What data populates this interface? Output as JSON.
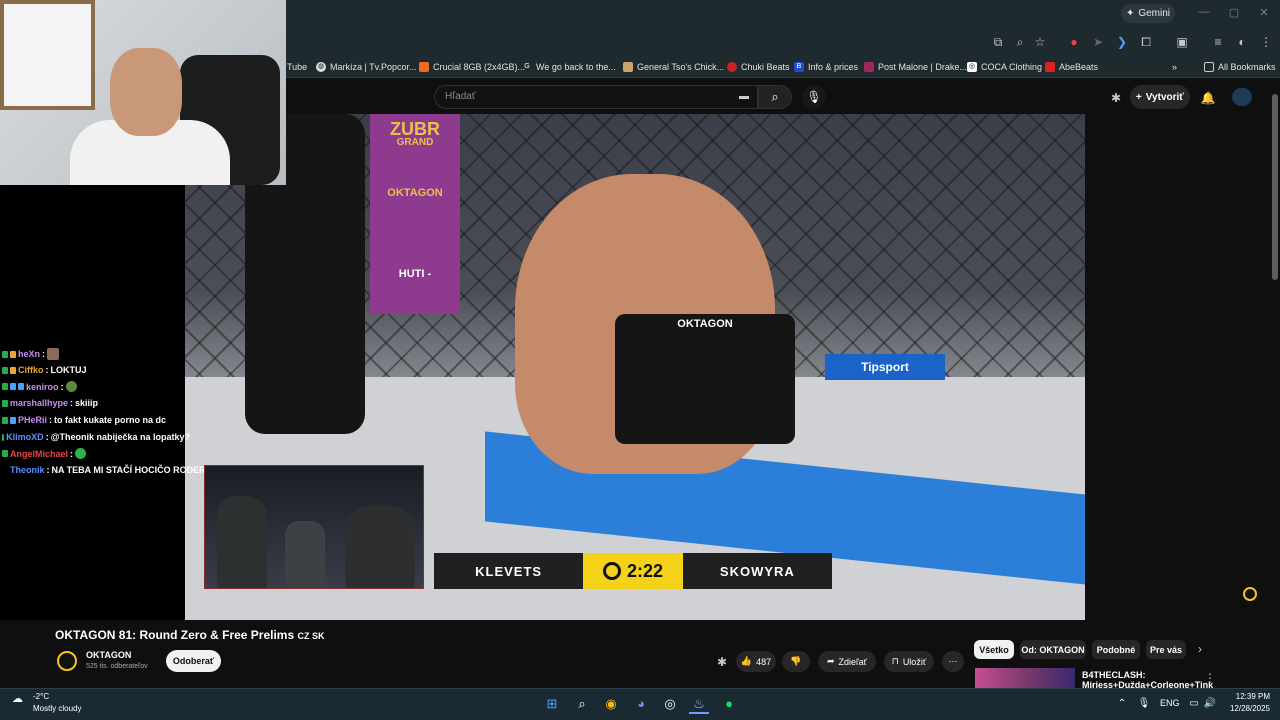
{
  "browser": {
    "gemini_label": "Gemini",
    "bookmarks": [
      {
        "label": "Tube",
        "icon": "youtube-icon"
      },
      {
        "label": "Markíza | Tv.Popcor...",
        "icon": "globe-icon"
      },
      {
        "label": "Crucial 8GB (2x4GB)...",
        "icon": "crucial-icon"
      },
      {
        "label": "We go back to the...",
        "icon": "google-icon"
      },
      {
        "label": "General Tso's Chick...",
        "icon": "recipe-icon"
      },
      {
        "label": "Chuki Beats",
        "icon": "chuki-icon"
      },
      {
        "label": "Info & prices",
        "icon": "b-icon"
      },
      {
        "label": "Post Malone | Drake...",
        "icon": "post-icon"
      },
      {
        "label": "COCA Clothing",
        "icon": "coca-icon"
      },
      {
        "label": "AbeBeats",
        "icon": "abebeats-icon"
      }
    ],
    "all_bookmarks": "All Bookmarks"
  },
  "youtube": {
    "search_placeholder": "Hľadať",
    "create_label": "Vytvoriť",
    "video_title": "OKTAGON 81: Round Zero & Free Prelims",
    "title_suffix": "CZ SK",
    "channel_name": "OKTAGON",
    "subscribers": "525 tis. odberateľov",
    "subscribe_label": "Odoberať",
    "likes": "487",
    "share_label": "Zdieľať",
    "save_label": "Uložiť",
    "chips": [
      "Všetko",
      "Od: OKTAGON",
      "Podobné",
      "Pre vás"
    ],
    "rec_title_1": "B4THECLASH:",
    "rec_title_2": "Mirjess+Dužda+Corleone+Tink"
  },
  "scoreboard": {
    "fighter_left": "KLEVETS",
    "time": "2:22",
    "fighter_right": "SKOWYRA"
  },
  "video_overlay": {
    "banner_zubr": "ZUBR",
    "banner_grand": "GRAND",
    "banner_oktagon": "OKTAGON",
    "tipsport": "Tipsport",
    "shorts_brand": "OKTAGON",
    "huti": "HUTI -"
  },
  "chat": [
    {
      "user": "heXn",
      "msg": "",
      "color": "#c98cf0"
    },
    {
      "user": "Ciffko",
      "msg": "LOKTUJ",
      "color": "#e8a33b"
    },
    {
      "user": "keniroo",
      "msg": "",
      "color": "#c98cf0"
    },
    {
      "user": "marshallhype",
      "msg": "skiiip",
      "color": "#c98cf0"
    },
    {
      "user": "PHeRii",
      "msg": "to fakt kukate porno na dc",
      "color": "#c98cf0"
    },
    {
      "user": "KlimoXD",
      "msg": "@Theonik nabiječka na lopatky?",
      "color": "#5d8dff"
    },
    {
      "user": "AngelMichael",
      "msg": "",
      "color": "#e84545"
    },
    {
      "user": "Theonik",
      "msg": "NA TEBA MI STAČÍ HOCIČO RODERIK",
      "color": "#5d8dff"
    }
  ],
  "taskbar": {
    "temp": "-2°C",
    "condition": "Mostly cloudy",
    "lang": "ENG",
    "time": "12:39 PM",
    "date": "12/28/2025"
  }
}
